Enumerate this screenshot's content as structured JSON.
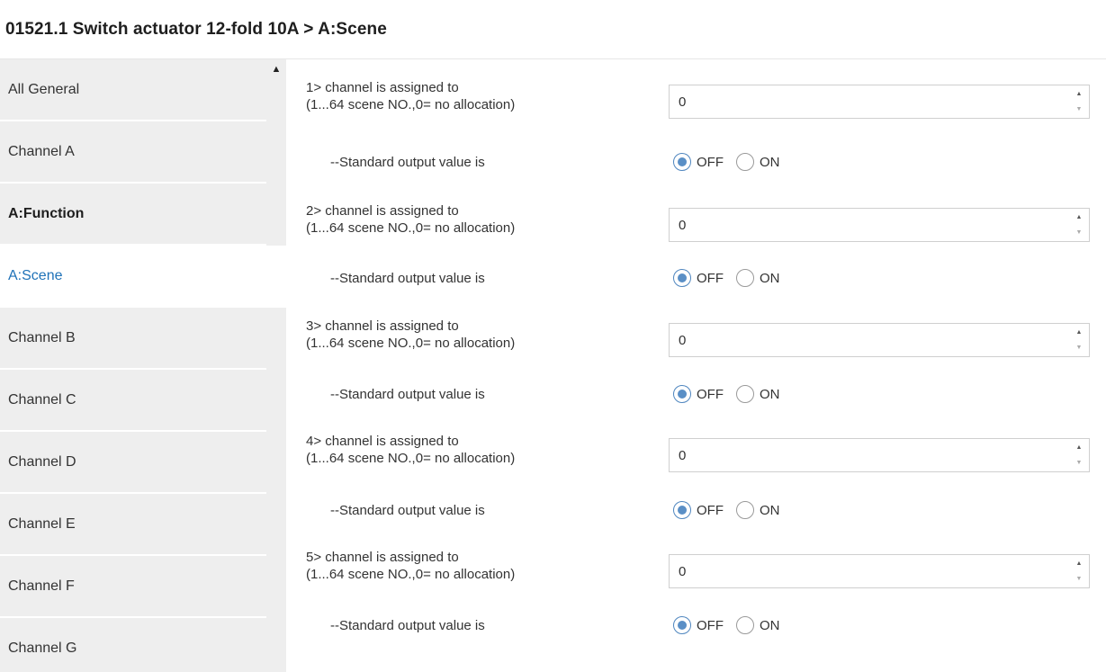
{
  "window": {
    "title": "01521.1 Switch actuator 12-fold 10A > A:Scene"
  },
  "sidebar": {
    "items": [
      {
        "label": "All General"
      },
      {
        "label": "Channel A"
      },
      {
        "label": "A:Function"
      },
      {
        "label": "A:Scene"
      },
      {
        "label": "Channel B"
      },
      {
        "label": "Channel C"
      },
      {
        "label": "Channel D"
      },
      {
        "label": "Channel E"
      },
      {
        "label": "Channel F"
      },
      {
        "label": "Channel G"
      }
    ],
    "selected": "A:Scene"
  },
  "scrollbar": {
    "up_glyph": "▲"
  },
  "params": [
    {
      "label_line1": "1> channel is assigned to",
      "label_line2": "(1...64 scene NO.,0= no allocation)",
      "value": "0",
      "std_label": "--Standard output value is",
      "off_label": "OFF",
      "on_label": "ON",
      "selected": "OFF"
    },
    {
      "label_line1": "2> channel is assigned to",
      "label_line2": "(1...64 scene NO.,0= no allocation)",
      "value": "0",
      "std_label": "--Standard output value is",
      "off_label": "OFF",
      "on_label": "ON",
      "selected": "OFF"
    },
    {
      "label_line1": "3> channel is assigned to",
      "label_line2": "(1...64 scene NO.,0= no allocation)",
      "value": "0",
      "std_label": "--Standard output value is",
      "off_label": "OFF",
      "on_label": "ON",
      "selected": "OFF"
    },
    {
      "label_line1": "4> channel is assigned to",
      "label_line2": "(1...64 scene NO.,0= no allocation)",
      "value": "0",
      "std_label": "--Standard output value is",
      "off_label": "OFF",
      "on_label": "ON",
      "selected": "OFF"
    },
    {
      "label_line1": "5> channel is assigned to",
      "label_line2": "(1...64 scene NO.,0= no allocation)",
      "value": "0",
      "std_label": "--Standard output value is",
      "off_label": "OFF",
      "on_label": "ON",
      "selected": "OFF"
    }
  ],
  "colors": {
    "accent": "#1f72b8",
    "sidebar_bg": "#eeeeee",
    "radio_dot": "#5a8fc6"
  }
}
